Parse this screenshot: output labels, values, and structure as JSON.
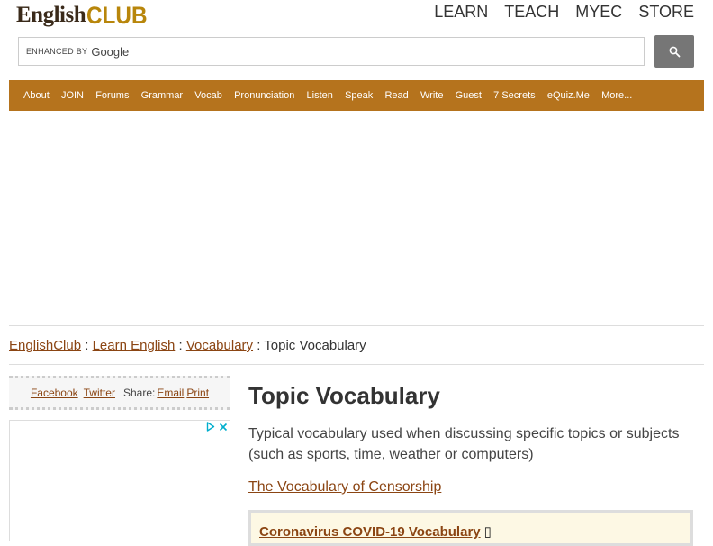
{
  "logo": {
    "part1": "English",
    "part2": "CLUB"
  },
  "topnav": {
    "learn": "LEARN",
    "teach": "TEACH",
    "myec": "MYEC",
    "store": "STORE"
  },
  "search": {
    "enhanced": "ENHANCED BY",
    "brand": "Google",
    "value": ""
  },
  "mainnav": [
    "About",
    "JOIN",
    "Forums",
    "Grammar",
    "Vocab",
    "Pronunciation",
    "Listen",
    "Speak",
    "Read",
    "Write",
    "Guest",
    "7 Secrets",
    "eQuiz.Me",
    "More..."
  ],
  "breadcrumb": {
    "home": "EnglishClub",
    "learn": "Learn English",
    "vocab": "Vocabulary",
    "current": "Topic Vocabulary",
    "sep": ":"
  },
  "share": {
    "facebook": "Facebook",
    "twitter": "Twitter",
    "label": "Share:",
    "email": "Email",
    "print": "Print"
  },
  "page": {
    "title": "Topic Vocabulary",
    "description": "Typical vocabulary used when discussing specific topics or subjects (such as sports, time, weather or computers)",
    "censorship_link": "The Vocabulary of Censorship",
    "covid_link": "Coronavirus COVID-19 Vocabulary",
    "covid_glyph": "▯"
  },
  "colors": {
    "nav_bg": "#b5731d",
    "link": "#8b4513",
    "search_btn": "#767676",
    "adchoices": "#00aecd"
  },
  "icons": {
    "search": "search-icon",
    "adchoices": "adchoices-icon",
    "close": "close-icon"
  }
}
